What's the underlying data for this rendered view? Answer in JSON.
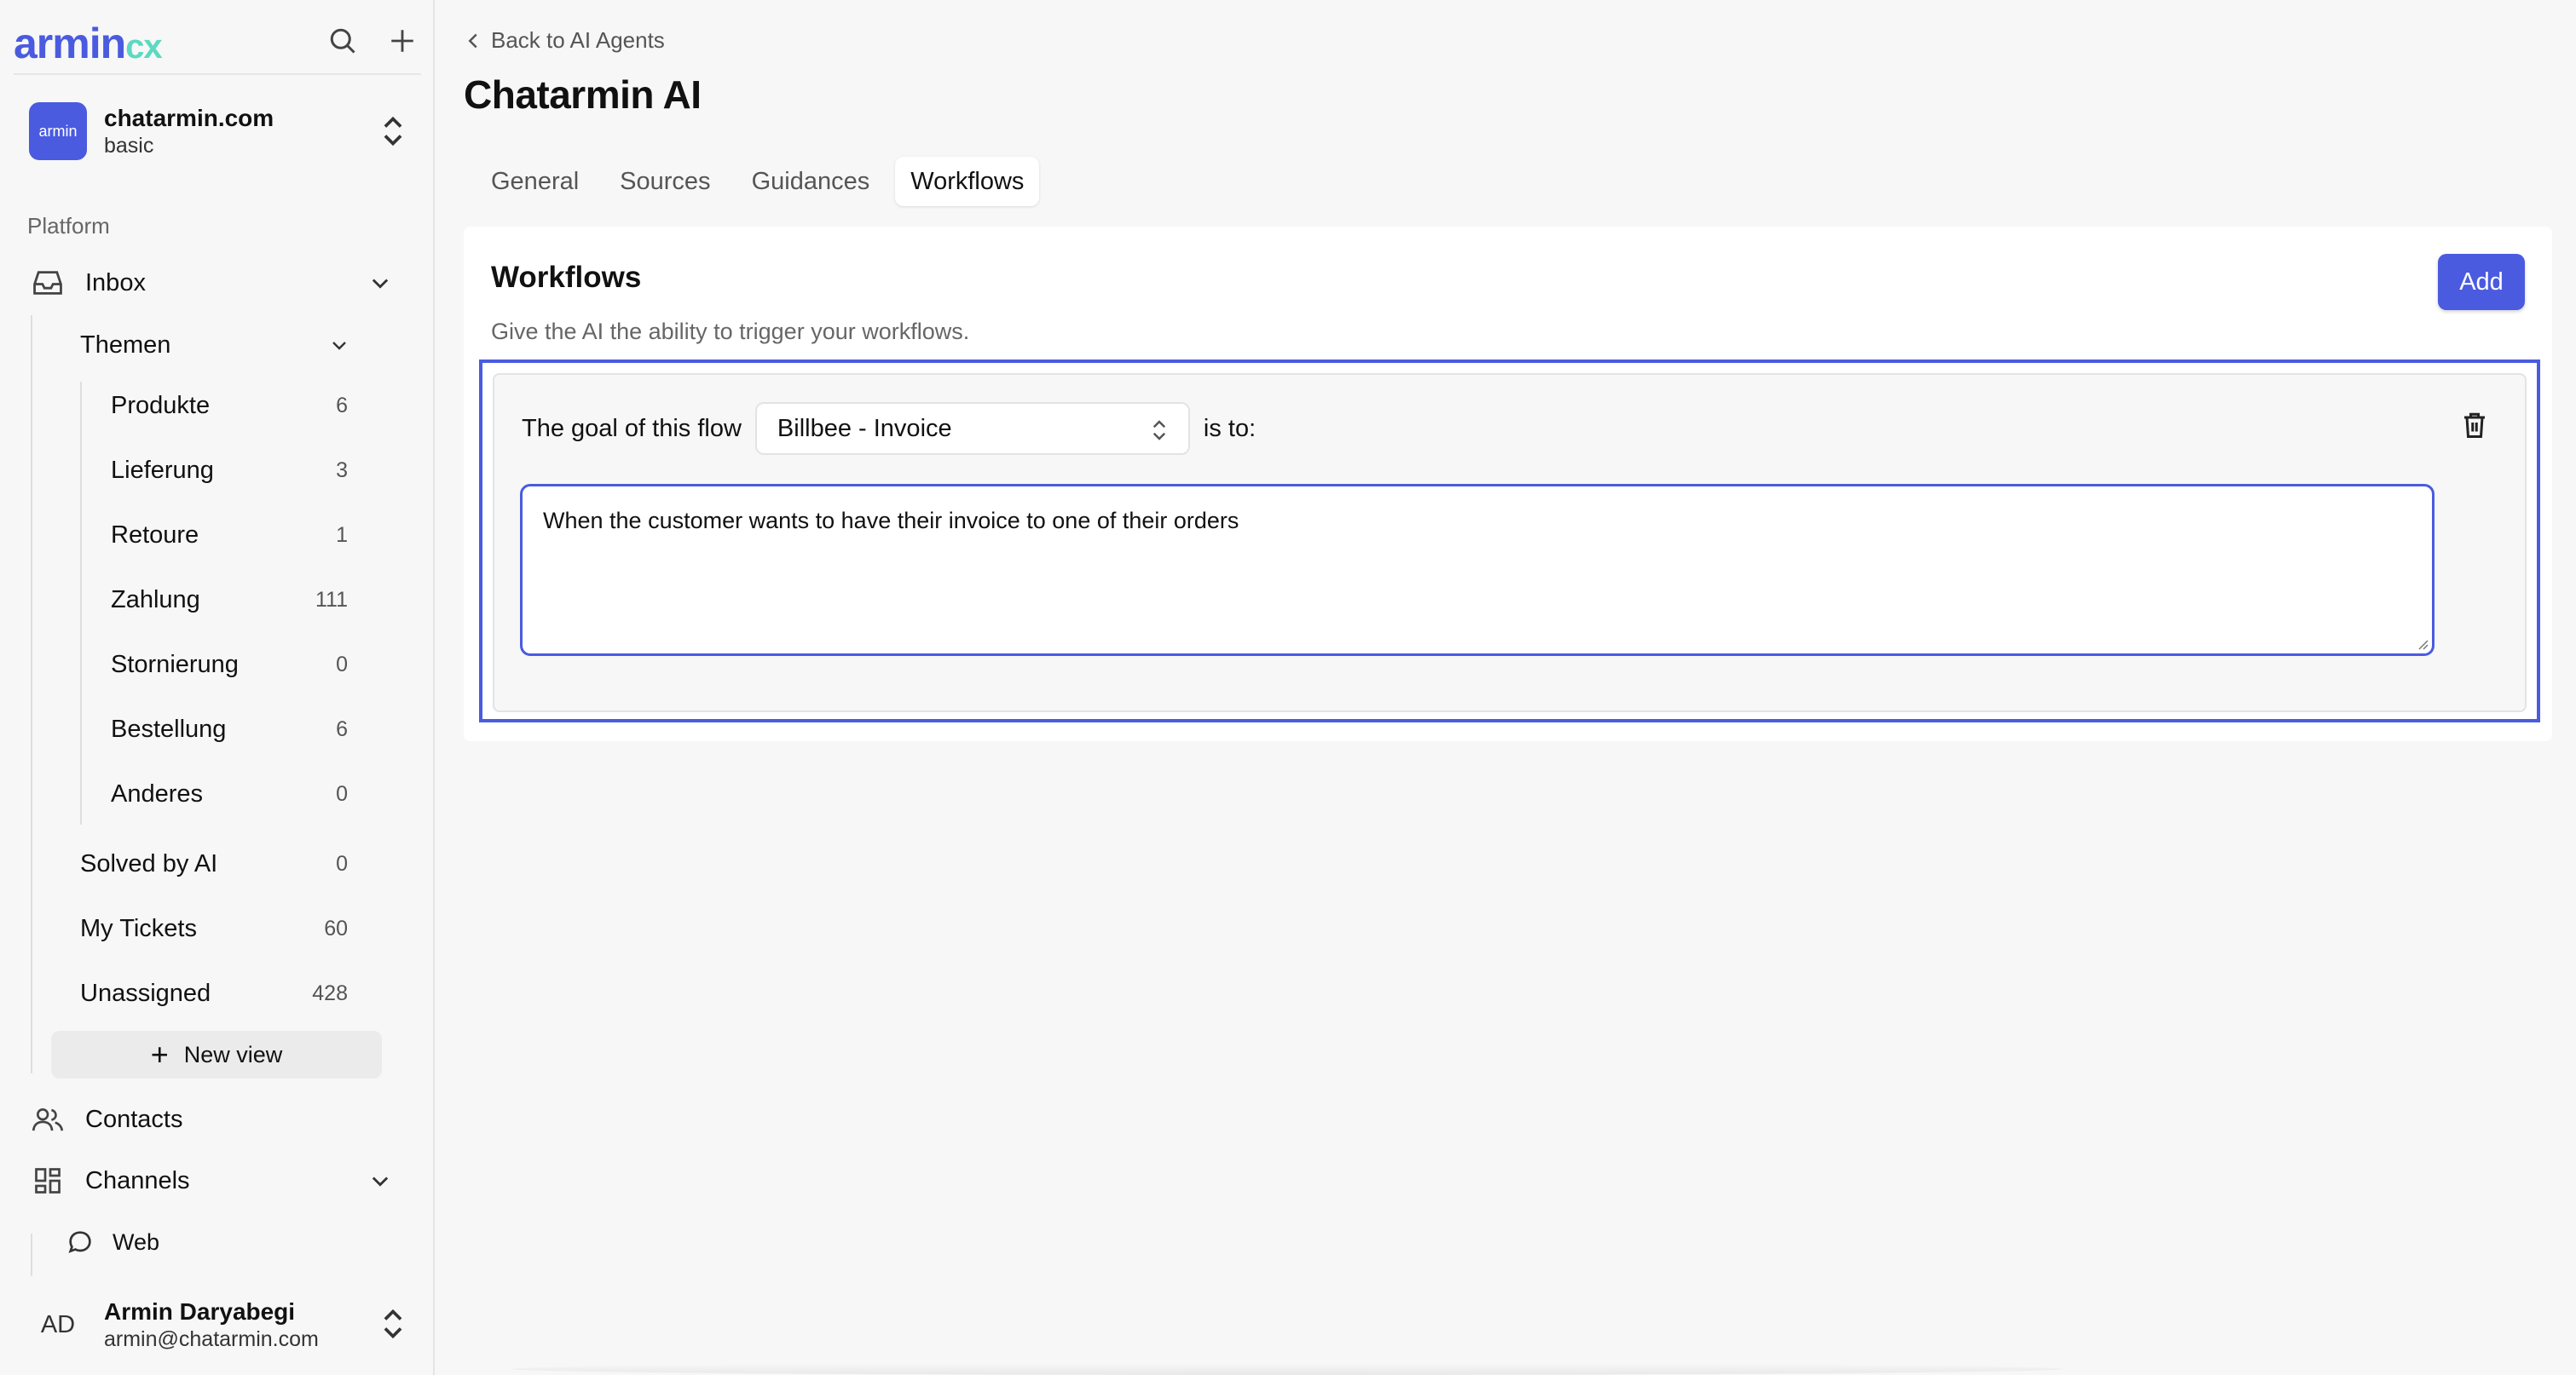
{
  "logo": {
    "primary": "armin",
    "secondary": "cx"
  },
  "org": {
    "avatar_text": "armin",
    "name": "chatarmin.com",
    "plan": "basic"
  },
  "sidebar": {
    "section_label": "Platform",
    "inbox": {
      "label": "Inbox"
    },
    "themen": {
      "label": "Themen"
    },
    "topics": [
      {
        "label": "Produkte",
        "count": "6"
      },
      {
        "label": "Lieferung",
        "count": "3"
      },
      {
        "label": "Retoure",
        "count": "1"
      },
      {
        "label": "Zahlung",
        "count": "111"
      },
      {
        "label": "Stornierung",
        "count": "0"
      },
      {
        "label": "Bestellung",
        "count": "6"
      },
      {
        "label": "Anderes",
        "count": "0"
      }
    ],
    "views": [
      {
        "label": "Solved by AI",
        "count": "0"
      },
      {
        "label": "My Tickets",
        "count": "60"
      },
      {
        "label": "Unassigned",
        "count": "428"
      }
    ],
    "new_view": "New view",
    "contacts": "Contacts",
    "channels": "Channels",
    "web": "Web"
  },
  "user": {
    "initials": "AD",
    "name": "Armin Daryabegi",
    "email": "armin@chatarmin.com"
  },
  "main": {
    "back_label": "Back to AI Agents",
    "title": "Chatarmin AI",
    "tabs": [
      {
        "label": "General",
        "active": false
      },
      {
        "label": "Sources",
        "active": false
      },
      {
        "label": "Guidances",
        "active": false
      },
      {
        "label": "Workflows",
        "active": true
      }
    ]
  },
  "workflows": {
    "title": "Workflows",
    "subtitle": "Give the AI the ability to trigger your workflows.",
    "add_label": "Add",
    "flow": {
      "prefix": "The goal of this flow",
      "selected": "Billbee - Invoice",
      "suffix": "is to:",
      "description": "When the customer wants to have their invoice to one of their orders"
    }
  },
  "colors": {
    "accent": "#4a5be0",
    "logo_secondary": "#5cd9c1",
    "background": "#f7f7f7"
  }
}
